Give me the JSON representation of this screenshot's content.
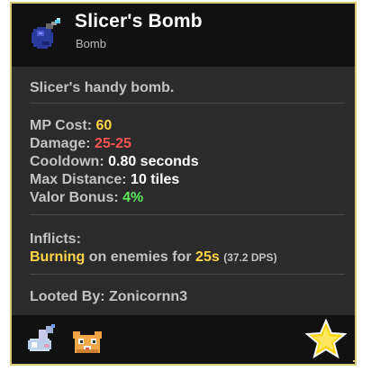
{
  "header": {
    "title": "Slicer's Bomb",
    "subtitle": "Bomb",
    "icon": "bomb-icon"
  },
  "description": "Slicer's handy bomb.",
  "stats": {
    "mp_cost_label": "MP Cost:",
    "mp_cost_value": "60",
    "damage_label": "Damage:",
    "damage_value": "25-25",
    "cooldown_label": "Cooldown:",
    "cooldown_value": "0.80 seconds",
    "max_distance_label": "Max Distance:",
    "max_distance_value": "10 tiles",
    "valor_bonus_label": "Valor Bonus:",
    "valor_bonus_value": "4%"
  },
  "inflicts": {
    "heading": "Inflicts:",
    "effect": "Burning",
    "middle": "on enemies for",
    "duration": "25s",
    "dps": "(37.2 DPS)"
  },
  "looted_by": "Looted By: Zonicornn3",
  "footer": {
    "icons": [
      "dye-icon",
      "pet-icon",
      "star-icon"
    ]
  },
  "colors": {
    "border": "#d8c870",
    "yellow": "#ffd64a",
    "red": "#ff5454",
    "green": "#5ee85e"
  }
}
